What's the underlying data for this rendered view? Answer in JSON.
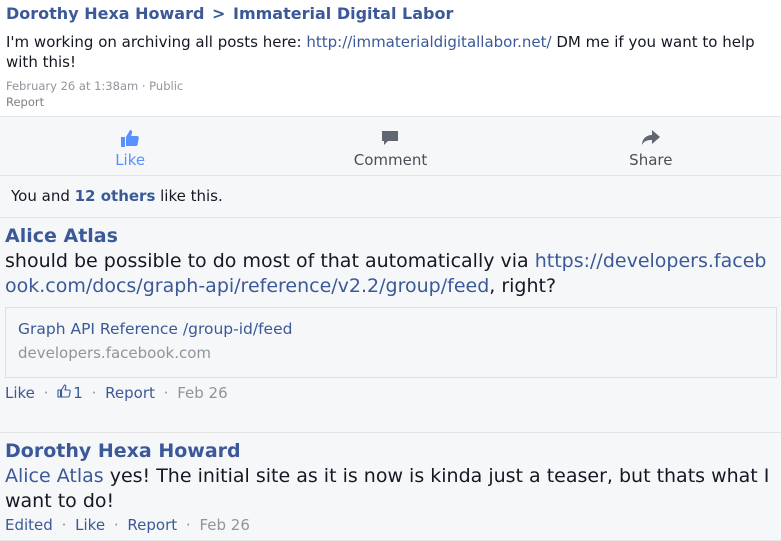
{
  "post": {
    "author": "Dorothy Hexa Howard",
    "separator": ">",
    "group": "Immaterial Digital Labor",
    "text_before": "I'm working on archiving all posts here: ",
    "link": "http://immaterialdigitallabor.net/",
    "text_after": " DM me if you want to help with this!",
    "timestamp": "February 26 at 1:38am",
    "dot": "·",
    "privacy": "Public",
    "report": "Report"
  },
  "actions": {
    "like": "Like",
    "comment": "Comment",
    "share": "Share"
  },
  "likes": {
    "prefix": "You and ",
    "others": "12 others",
    "suffix": " like this."
  },
  "comments": [
    {
      "author": "Alice Atlas",
      "text_before": "should be possible to do most of that automatically via ",
      "link": "https://developers.facebook.com/docs/graph-api/reference/v2.2/group/feed",
      "text_after": ", right?",
      "card_title": "Graph API Reference /group-id/feed",
      "card_domain": "developers.facebook.com",
      "like": "Like",
      "like_count": "1",
      "report": "Report",
      "date": "Feb 26",
      "sep": "·"
    },
    {
      "author": "Dorothy Hexa Howard",
      "mention": "Alice Atlas",
      "text": " yes! The initial site as it is now is kinda just a teaser, but thats what I want to do!",
      "edited": "Edited",
      "like": "Like",
      "report": "Report",
      "date": "Feb 26",
      "sep": "·"
    }
  ],
  "colors": {
    "link": "#3b5998",
    "like_active": "#5890ff",
    "muted": "#90949c",
    "panel": "#f6f7f9"
  },
  "icons": [
    "thumbs-up-icon",
    "comment-icon",
    "share-icon",
    "small-thumbs-up-icon"
  ]
}
